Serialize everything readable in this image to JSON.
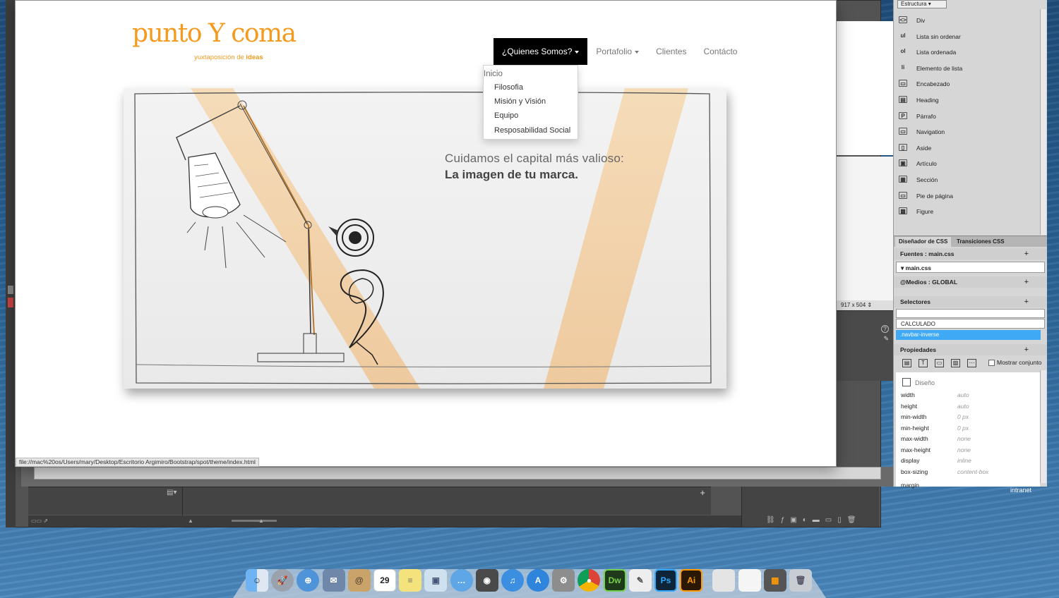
{
  "browser": {
    "logo_main": "punto Y coma",
    "logo_tagline_prefix": "yuxtaposición de ",
    "logo_tagline_bold": "ideas",
    "nav": [
      {
        "label": "¿Quienes Somos?",
        "dropdown": true,
        "active": true
      },
      {
        "label": "Portafolio",
        "dropdown": true,
        "active": false
      },
      {
        "label": "Clientes",
        "dropdown": false,
        "active": false
      },
      {
        "label": "Contácto",
        "dropdown": false,
        "active": false
      }
    ],
    "dropdown": {
      "header": "Inicio",
      "items": [
        "Filosofia",
        "Misión y Visión",
        "Equipo",
        "Resposabilidad Social"
      ]
    },
    "hero_line1": "Cuidamos el capital más valioso:",
    "hero_line2": "La imagen de tu marca.",
    "status_url": "file://mac%20os/Users/mary/Desktop/Escritorio Argimiro/Bootstrap/spot/theme/index.html"
  },
  "dreamweaver": {
    "size_readout": "917 x 504 ⇕"
  },
  "panel": {
    "structure_select": "Estructura",
    "structure_items": [
      {
        "icon": "<>",
        "label": "Div"
      },
      {
        "icon": "ul",
        "label": "Lista sin ordenar"
      },
      {
        "icon": "ol",
        "label": "Lista ordenada"
      },
      {
        "icon": "li",
        "label": "Elemento de lista"
      },
      {
        "icon": "▭",
        "label": "Encabezado"
      },
      {
        "icon": "▤",
        "label": "Heading"
      },
      {
        "icon": "P",
        "label": "Párrafo"
      },
      {
        "icon": "▭",
        "label": "Navigation"
      },
      {
        "icon": "▯",
        "label": "Aside"
      },
      {
        "icon": "▣",
        "label": "Artículo"
      },
      {
        "icon": "▦",
        "label": "Sección"
      },
      {
        "icon": "▭",
        "label": "Pie de página"
      },
      {
        "icon": "▩",
        "label": "Figure"
      }
    ],
    "css_tab_1": "Diseñador de CSS",
    "css_tab_2": "Transiciones CSS",
    "sources_label": "Fuentes : main.css",
    "source_file": "main.css",
    "media_label": "@Medios : GLOBAL",
    "selectors_label": "Selectores",
    "selector_computed": "CALCULADO",
    "selector_selected": ".navbar-inverse",
    "properties_label": "Propiedades",
    "show_set_label": "Mostrar conjunto",
    "group_label": "Diseño",
    "props": [
      {
        "name": "width",
        "value": "auto"
      },
      {
        "name": "height",
        "value": "auto"
      },
      {
        "name": "min-width",
        "value": "0 px"
      },
      {
        "name": "min-height",
        "value": "0 px"
      },
      {
        "name": "max-width",
        "value": "none"
      },
      {
        "name": "max-height",
        "value": "none"
      },
      {
        "name": "display",
        "value": "inline"
      },
      {
        "name": "box-sizing",
        "value": "content-box"
      },
      {
        "name": "margin",
        "value": ""
      }
    ],
    "desktop_label": "intranet"
  },
  "dock": {
    "calendar_day": "29",
    "apps": [
      "finder",
      "launchpad",
      "safari",
      "mail-stamp",
      "contacts",
      "calendar",
      "notes",
      "preview",
      "messages",
      "facetime",
      "itunes",
      "app-store",
      "system-preferences",
      "chrome",
      "dreamweaver",
      "textedit",
      "photoshop",
      "illustrator",
      "document",
      "document",
      "illustrator-file",
      "trash"
    ],
    "dw_label": "Dw",
    "ps_label": "Ps",
    "ai_label": "Ai"
  }
}
